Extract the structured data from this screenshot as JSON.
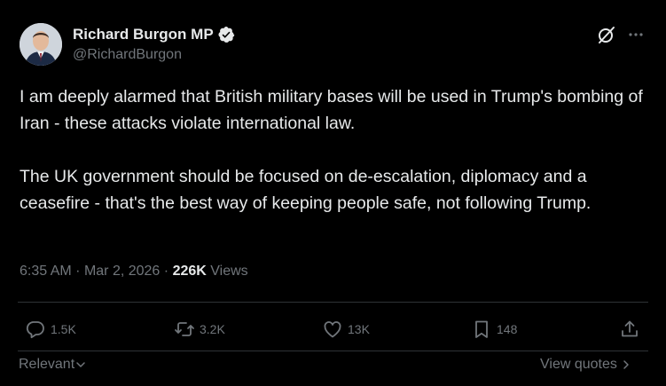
{
  "author": {
    "display_name": "Richard Burgon MP",
    "handle": "@RichardBurgon",
    "verified": true
  },
  "tweet": {
    "paragraphs": [
      "I am deeply alarmed that British military bases will be used in Trump's bombing of Iran - these attacks violate international law.",
      "The UK government should be focused on de-escalation, diplomacy and a ceasefire - that's the best way of keeping people safe, not following Trump."
    ],
    "time": "6:35 AM",
    "separator": "·",
    "date": "Mar 2, 2026",
    "views_count": "226K",
    "views_label": "Views"
  },
  "actions": {
    "replies": "1.5K",
    "reposts": "3.2K",
    "likes": "13K",
    "bookmarks": "148"
  },
  "footer": {
    "sort_label": "Relevant",
    "view_quotes_label": "View quotes"
  },
  "colors": {
    "background": "#000000",
    "text": "#e7e9ea",
    "muted": "#71767b",
    "divider": "#2f3336",
    "verified": "#e7e9ea"
  },
  "icons": {
    "verified": "verified-badge-icon",
    "grok": "grok-icon",
    "more": "more-dots-icon",
    "reply": "reply-bubble-icon",
    "repost": "repost-arrows-icon",
    "like": "heart-icon",
    "bookmark": "bookmark-icon",
    "share": "share-upload-icon"
  }
}
